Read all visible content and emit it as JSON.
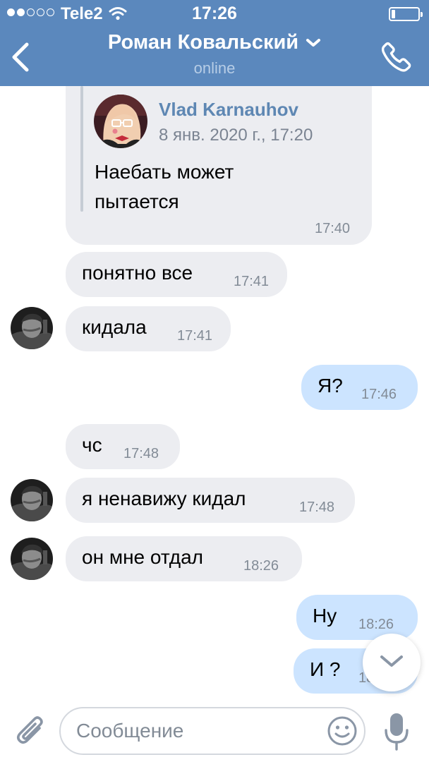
{
  "status_bar": {
    "carrier": "Tele2",
    "time": "17:26",
    "signal_total": 5,
    "signal_filled": 2,
    "battery_level": 0.15,
    "icons": [
      "wifi-icon",
      "battery-icon"
    ]
  },
  "header": {
    "title": "Роман Ковальский",
    "status": "online",
    "icons": [
      "back-icon",
      "chevron-down-icon",
      "phone-icon"
    ],
    "background": "#5b88bd"
  },
  "forwarded": {
    "author": "Vlad Karnauhov",
    "date": "8 янв. 2020 г., 17:20",
    "text": "Наебать может\nпытается",
    "time": "17:40"
  },
  "messages": [
    {
      "text": "понятно все",
      "time": "17:41",
      "direction": "in"
    },
    {
      "text": "кидала",
      "time": "17:41",
      "direction": "in"
    },
    {
      "text": "Я?",
      "time": "17:46",
      "direction": "out"
    },
    {
      "text": "чс",
      "time": "17:48",
      "direction": "in"
    },
    {
      "text": "я ненавижу кидал",
      "time": "17:48",
      "direction": "in"
    },
    {
      "text": "он мне отдал",
      "time": "18:26",
      "direction": "in"
    },
    {
      "text": "Ну",
      "time": "18:26",
      "direction": "out"
    },
    {
      "text": "И ?",
      "time": "18:26",
      "direction": "out"
    }
  ],
  "input": {
    "placeholder": "Сообщение",
    "value": "",
    "icons": [
      "paperclip-icon",
      "smiley-icon",
      "microphone-icon"
    ]
  },
  "scroll_button": {
    "icon": "chevron-down-icon"
  },
  "colors": {
    "incoming_bubble": "#ecedf1",
    "outgoing_bubble": "#cce4ff",
    "accent": "#5e87b3"
  }
}
